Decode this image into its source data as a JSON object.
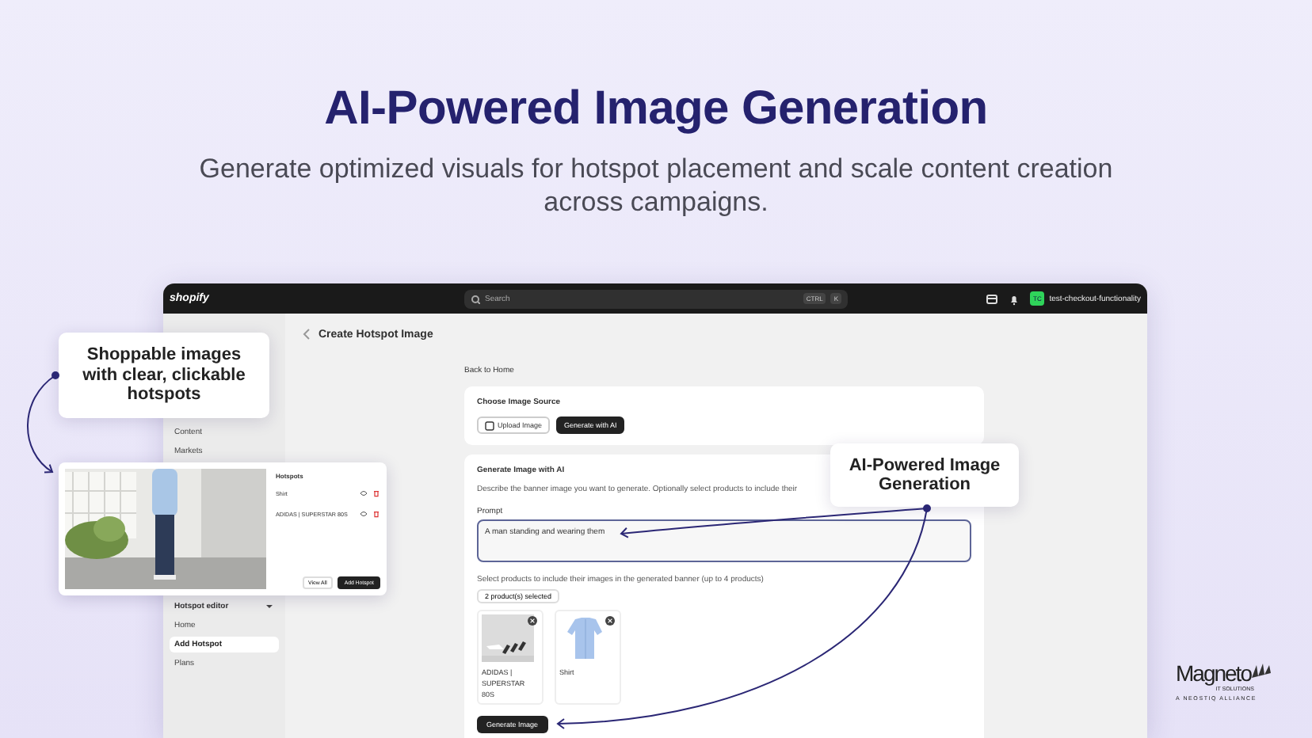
{
  "header": {
    "title": "AI-Powered Image Generation",
    "subtitle": "Generate optimized visuals for hotspot placement and scale content creation across campaigns."
  },
  "topbar": {
    "logo": "shopify",
    "search": {
      "placeholder": "Search"
    },
    "shortcut": [
      "CTRL",
      "K"
    ],
    "store_initials": "TC",
    "store_name": "test-checkout-functionality"
  },
  "sidebar": {
    "items": [
      {
        "label": "Content",
        "selected": false
      },
      {
        "label": "Markets",
        "selected": false
      }
    ],
    "section": {
      "label": "Hotspot editor",
      "expanded": true,
      "items": [
        {
          "label": "Home",
          "selected": false
        },
        {
          "label": "Add Hotspot",
          "selected": true
        },
        {
          "label": "Plans",
          "selected": false
        }
      ]
    }
  },
  "page": {
    "title": "Create Hotspot Image",
    "back_link": "Back to Home",
    "source_card": {
      "title": "Choose Image Source",
      "options": [
        {
          "label": "Upload Image",
          "selected": false
        },
        {
          "label": "Generate with AI",
          "selected": true
        }
      ]
    },
    "generate_card": {
      "title": "Generate Image with AI",
      "description": "Describe the banner image you want to generate. Optionally select products to include their",
      "prompt_label": "Prompt",
      "prompt_value": "A man standing and wearing them",
      "products_hint": "Select products to include their images in the generated banner (up to 4 products)",
      "products_button": "2 product(s) selected",
      "products": [
        {
          "name": "ADIDAS | SUPERSTAR 80S",
          "kind": "shoe"
        },
        {
          "name": "Shirt",
          "kind": "shirt"
        }
      ],
      "generate_button": "Generate Image"
    }
  },
  "callouts": [
    {
      "text": "Shoppable images with clear, clickable hotspots"
    },
    {
      "text": "AI-Powered Image Generation"
    }
  ],
  "hotspot_popup": {
    "title": "Hotspots",
    "items": [
      "Shirt",
      "ADIDAS | SUPERSTAR 80S"
    ],
    "buttons": [
      "View All",
      "Add Hotspot"
    ]
  },
  "brand": {
    "name": "Magneto",
    "tagline": "IT SOLUTIONS",
    "alliance": "A NEOSTIQ ALLIANCE"
  }
}
